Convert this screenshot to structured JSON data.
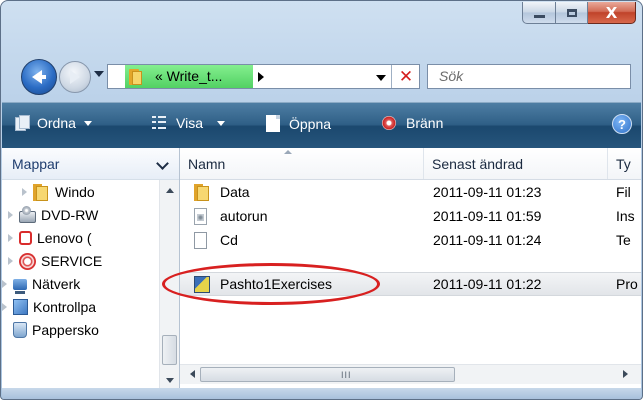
{
  "window": {
    "caption": {
      "minimize": "–",
      "maximize": "□",
      "close": "X"
    }
  },
  "address": {
    "chevron_crumb": "«  Write_t...",
    "clear": "✕"
  },
  "search": {
    "placeholder": "Sök"
  },
  "toolbar": {
    "ordna": "Ordna",
    "visa": "Visa",
    "oppna": "Öppna",
    "branna": "Bränn",
    "help": "?"
  },
  "navpane": {
    "header": "Mappar",
    "items": [
      {
        "label": "Windo",
        "icon": "folder-icon"
      },
      {
        "label": "DVD-RW",
        "icon": "dvd-drive-icon"
      },
      {
        "label": "Lenovo (",
        "icon": "lenovo-drive-icon"
      },
      {
        "label": "SERVICE",
        "icon": "service-drive-icon"
      },
      {
        "label": "Nätverk",
        "icon": "network-icon"
      },
      {
        "label": "Kontrollpa",
        "icon": "control-panel-icon"
      },
      {
        "label": "Pappersko",
        "icon": "recycle-bin-icon"
      }
    ]
  },
  "filelist": {
    "columns": [
      "Namn",
      "Senast ändrad",
      "Ty"
    ],
    "rows": [
      {
        "name": "Data",
        "modified": "2011-09-11 01:23",
        "type": "Fil",
        "icon": "folder-icon"
      },
      {
        "name": "autorun",
        "modified": "2011-09-11 01:59",
        "type": "Ins",
        "icon": "setup-info-icon"
      },
      {
        "name": "Cd",
        "modified": "2011-09-11 01:24",
        "type": "Te",
        "icon": "text-file-icon"
      },
      {
        "name": "Pashto1Exercises",
        "modified": "2011-09-11 01:22",
        "type": "Pro",
        "icon": "program-icon"
      }
    ],
    "scroll_grip": "III"
  },
  "colors": {
    "highlight_circle": "#d82020",
    "toolbar": "#2f5f86",
    "crumb": "#52d163"
  }
}
